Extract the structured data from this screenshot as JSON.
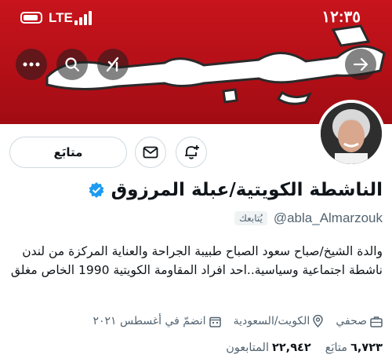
{
  "status_bar": {
    "time": "١٢:٣٥",
    "network": "LTE"
  },
  "banner": {
    "word": "كويت",
    "background_color": "#b8111a"
  },
  "header_buttons": {
    "back_icon": "arrow-right-icon",
    "grok_icon": "grok-icon",
    "search_icon": "search-icon",
    "more_icon": "more-icon"
  },
  "actions": {
    "follow_label": "متابَع",
    "message_icon": "envelope-icon",
    "notify_icon": "bell-plus-icon"
  },
  "profile": {
    "display_name": "الناشطة الكويتية/عبلة المرزوق",
    "verified": true,
    "verified_color": "#1d9bf0",
    "handle": "@abla_Almarzouk",
    "follows_you": "يُتابعك",
    "bio": "والدة الشيخ/صباح سعود الصباح طبيبة الجراحة والعناية المركزة من لندن ناشطة اجتماعية وسياسية..احد افراد المقاومة الكويتية 1990 الخاص مغلق",
    "category": "صحفي",
    "location": "الكويت/السعودية",
    "joined": "انضمّ في أغسطس ٢٠٢١"
  },
  "stats": {
    "following_count": "٦,٧٢٣",
    "following_label": "متابَع",
    "followers_count": "٢٢,٩٤٢",
    "followers_label": "المتابعون"
  }
}
